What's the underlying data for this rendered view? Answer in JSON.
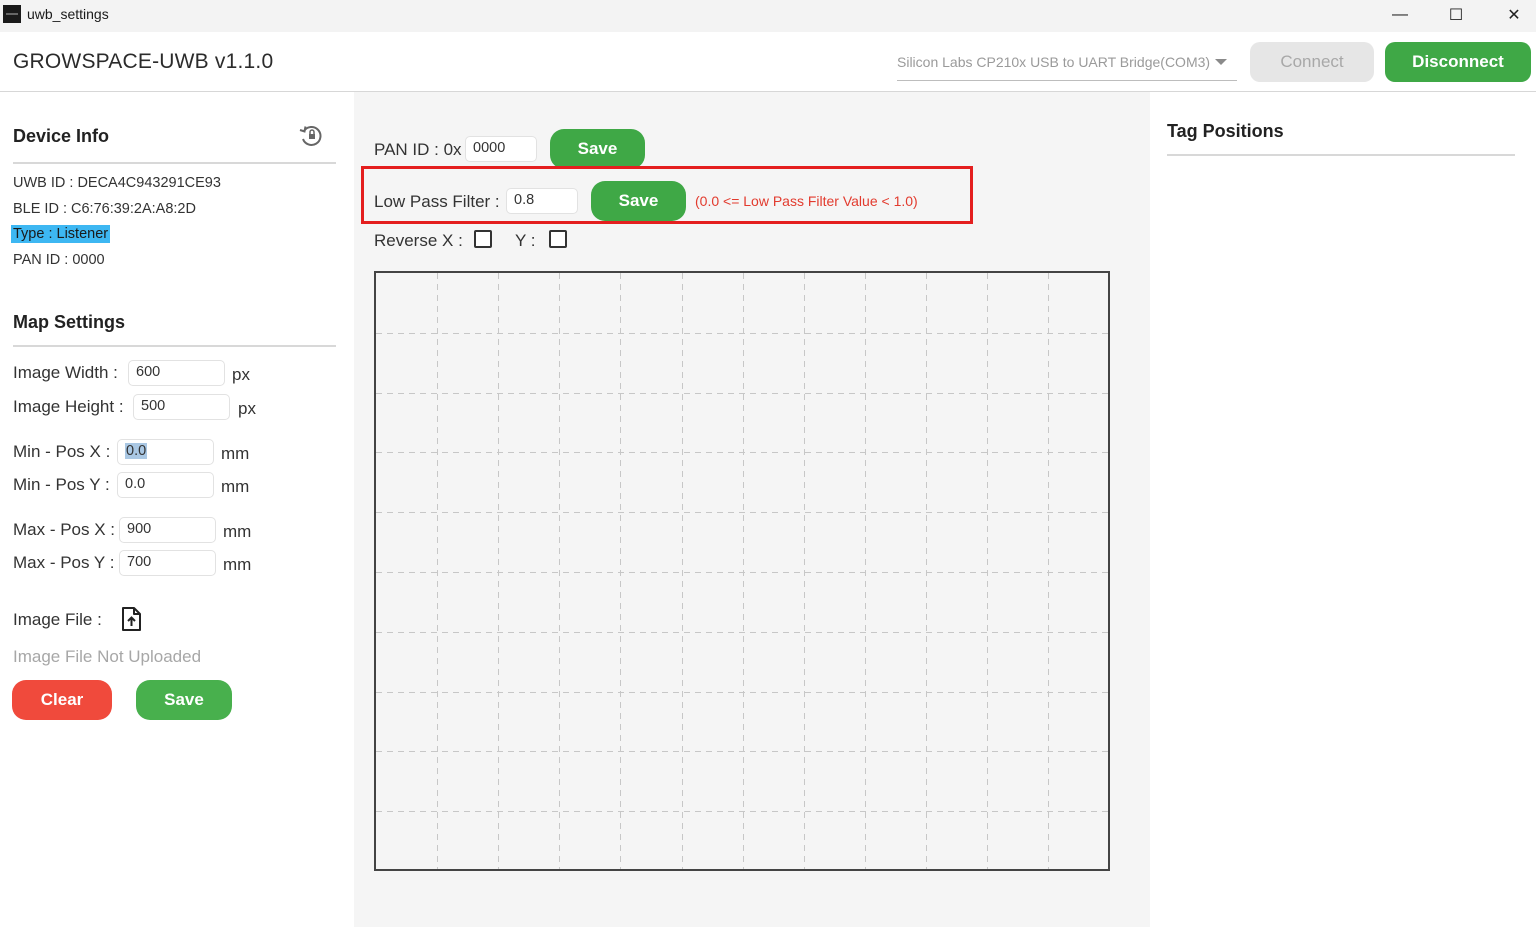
{
  "window": {
    "title": "uwb_settings",
    "minimize_glyph": "—",
    "maximize_glyph": "☐",
    "close_glyph": "✕"
  },
  "header": {
    "app_title": "GROWSPACE-UWB v1.1.0",
    "port_selected": "Silicon Labs CP210x USB to UART Bridge(COM3)",
    "connect_label": "Connect",
    "disconnect_label": "Disconnect"
  },
  "device_info": {
    "title": "Device Info",
    "uwb_id": "UWB ID : DECA4C943291CE93",
    "ble_id": "BLE ID : C6:76:39:2A:A8:2D",
    "type": "Type : Listener",
    "pan_id": "PAN ID : 0000"
  },
  "map_settings": {
    "title": "Map Settings",
    "image_width_label": "Image Width :",
    "image_width_value": "600",
    "image_height_label": "Image Height :",
    "image_height_value": "500",
    "px_unit": "px",
    "mm_unit": "mm",
    "min_x_label": "Min - Pos X :",
    "min_x_value": "0.0",
    "min_y_label": "Min - Pos Y :",
    "min_y_value": "0.0",
    "max_x_label": "Max - Pos X :",
    "max_x_value": "900",
    "max_y_label": "Max - Pos Y :",
    "max_y_value": "700",
    "image_file_label": "Image File :",
    "image_file_status": "Image File Not Uploaded",
    "clear_label": "Clear",
    "save_label": "Save"
  },
  "controls": {
    "pan_label": "PAN ID : 0x",
    "pan_value": "0000",
    "pan_save_label": "Save",
    "lpf_label": "Low Pass Filter :",
    "lpf_value": "0.8",
    "lpf_save_label": "Save",
    "lpf_hint": "(0.0 <= Low Pass Filter Value < 1.0)",
    "reverse_x_label": "Reverse X :",
    "reverse_y_label": "Y :",
    "reverse_x_checked": false,
    "reverse_y_checked": false
  },
  "map": {
    "grid_columns": 12,
    "grid_rows": 10
  },
  "tag_positions": {
    "title": "Tag Positions"
  },
  "colors": {
    "accent_green": "#3fa846",
    "danger_red": "#f04a3c",
    "highlight_blue": "#3db7f2",
    "annotation_red": "#e41f1f"
  }
}
